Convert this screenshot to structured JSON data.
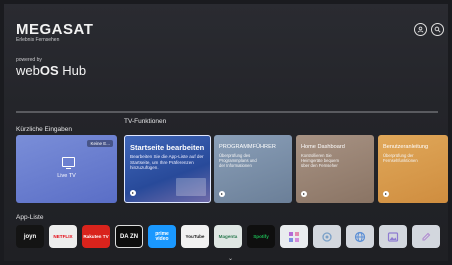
{
  "brand": {
    "name": "MEGASAT",
    "tagline": "Erlebnis Fernsehen",
    "powered": "powered by",
    "hub_prefix": "web",
    "hub_os": "OS",
    "hub_suffix": " Hub"
  },
  "header": {
    "icons": [
      "profile-icon",
      "search-icon"
    ]
  },
  "recent": {
    "label": "Kürzliche Eingaben",
    "tile_tag": "Keine E...",
    "tile_label": "Live TV"
  },
  "features": {
    "label": "TV-Funktionen",
    "main": {
      "title": "Startseite bearbeiten",
      "desc": "Bearbeiten Sie die App-Liste auf der Startseite, um Ihre Präferenzen hinzuzufügen."
    },
    "cards": [
      {
        "title": "PROGRAMMFÜHRER",
        "desc": "Überprüfung des Programmplans und der Informationen"
      },
      {
        "title": "Home Dashboard",
        "desc": "Kontrollieren Sie Heimgeräte bequem über den Fernseher"
      },
      {
        "title": "Benutzeranleitung",
        "desc": "Überprüfung der Fernsehfunktionen"
      }
    ]
  },
  "apps": {
    "label": "App-Liste",
    "items": [
      {
        "label": "joyn"
      },
      {
        "label": "NETFLIX"
      },
      {
        "label": "Rakuten TV"
      },
      {
        "label": "DA ZN"
      },
      {
        "label": "prime video"
      },
      {
        "label": "YouTube"
      },
      {
        "label": "Magenta"
      },
      {
        "label": "Spotify"
      },
      {
        "label": ""
      },
      {
        "label": ""
      },
      {
        "label": ""
      },
      {
        "label": ""
      },
      {
        "label": ""
      }
    ]
  }
}
